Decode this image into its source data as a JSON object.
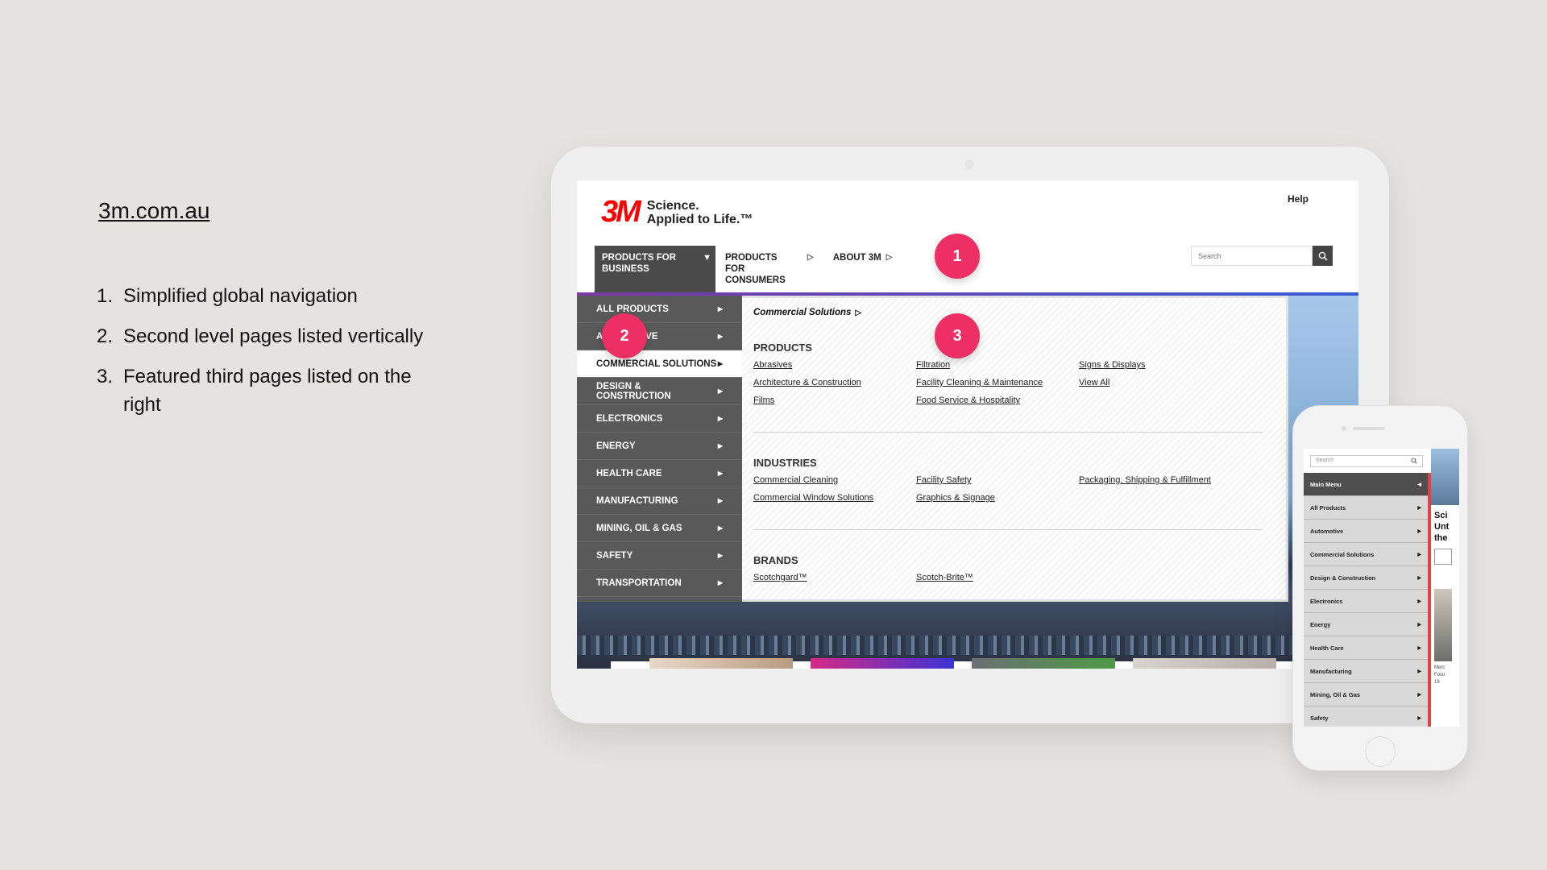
{
  "annotation": {
    "site": "3m.com.au",
    "notes": [
      {
        "num": "1.",
        "text": "Simplified global navigation"
      },
      {
        "num": "2.",
        "text": "Second level pages listed vertically"
      },
      {
        "num": "3.",
        "text": "Featured third pages listed on the right"
      }
    ]
  },
  "header": {
    "logo_mark": "3M",
    "tagline_1": "Science.",
    "tagline_2": "Applied to Life.™",
    "help": "Help",
    "search_placeholder": "Search"
  },
  "nav": {
    "business": "PRODUCTS FOR BUSINESS",
    "business_caret": "▼",
    "consumers": "PRODUCTS FOR CONSUMERS",
    "about": "ABOUT 3M",
    "tri": "▷"
  },
  "side_menu": [
    {
      "label": "ALL PRODUCTS",
      "active": false
    },
    {
      "label": "AUTOMOTIVE",
      "active": false
    },
    {
      "label": "COMMERCIAL SOLUTIONS",
      "active": true
    },
    {
      "label": "DESIGN & CONSTRUCTION",
      "active": false
    },
    {
      "label": "ELECTRONICS",
      "active": false
    },
    {
      "label": "ENERGY",
      "active": false
    },
    {
      "label": "HEALTH CARE",
      "active": false
    },
    {
      "label": "MANUFACTURING",
      "active": false
    },
    {
      "label": "MINING, OIL & GAS",
      "active": false
    },
    {
      "label": "SAFETY",
      "active": false
    },
    {
      "label": "TRANSPORTATION",
      "active": false
    }
  ],
  "panel": {
    "crumb": "Commercial Solutions",
    "products_heading": "PRODUCTS",
    "products": [
      "Abrasives",
      "Filtration",
      "Signs & Displays",
      "Architecture & Construction",
      "Facility Cleaning & Maintenance",
      "View All",
      "Films",
      "Food Service & Hospitality",
      ""
    ],
    "industries_heading": "INDUSTRIES",
    "industries": [
      "Commercial Cleaning",
      "Facility Safety",
      "Packaging, Shipping & Fulfillment",
      "Commercial Window Solutions",
      "Graphics & Signage",
      ""
    ],
    "brands_heading": "BRANDS",
    "brands": [
      "Scotchgard™",
      "Scotch-Brite™"
    ]
  },
  "badges": [
    "1",
    "2",
    "3"
  ],
  "phone": {
    "search_placeholder": "Search",
    "menu": [
      "Main Menu",
      "All Products",
      "Automotive",
      "Commercial Solutions",
      "Design & Construction",
      "Electronics",
      "Energy",
      "Health Care",
      "Manufacturing",
      "Mining, Oil & Gas",
      "Safety"
    ],
    "right_text_1": "Sci",
    "right_text_2": "Unt",
    "right_text_3": "the",
    "right_small_1": "Merc",
    "right_small_2": "Focu",
    "right_small_3": "19"
  },
  "colors": {
    "badge": "#ee2f63",
    "brand_red": "#ff0000",
    "menu_dark": "#595959"
  }
}
